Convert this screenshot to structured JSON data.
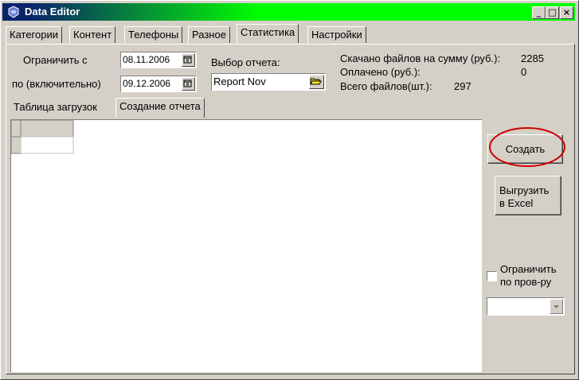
{
  "window": {
    "title": "Data Editor",
    "minimize": "_",
    "maximize": "□",
    "close": "×"
  },
  "tabs": [
    {
      "label": "Категории"
    },
    {
      "label": "Контент"
    },
    {
      "label": "Телефоны"
    },
    {
      "label": "Разное"
    },
    {
      "label": "Статистика"
    },
    {
      "label": "Настройки"
    }
  ],
  "filters": {
    "from_label": "Ограничить с",
    "from_value": "08.11.2006",
    "to_label": "по (включительно)",
    "to_value": "09.12.2006",
    "report_label": "Выбор отчета:",
    "report_value": "Report Nov"
  },
  "stats": {
    "downloaded_label": "Скачано файлов на сумму (руб.):",
    "downloaded_value": "2285",
    "paid_label": "Оплачено (руб.):",
    "paid_value": "0",
    "total_label": "Всего файлов(шт.):",
    "total_value": "297"
  },
  "subtabs": [
    {
      "label": "Таблица загрузок"
    },
    {
      "label": "Создание отчета"
    }
  ],
  "actions": {
    "create_label": "Создать",
    "export_line1": "Выгрузить",
    "export_line2": "в Excel",
    "limit_line1": "Ограничить",
    "limit_line2": "по пров-ру"
  },
  "colors": {
    "highlight_circle": "#d00000",
    "title_start": "#0a246a",
    "title_end": "#00ff00"
  }
}
